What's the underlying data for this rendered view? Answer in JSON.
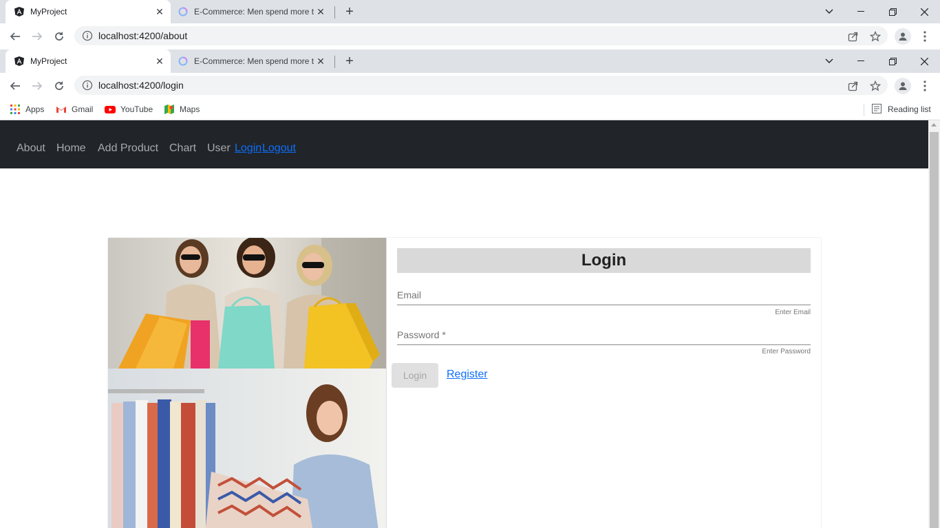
{
  "browser_top": {
    "tabs": [
      {
        "title": "MyProject"
      },
      {
        "title": "E-Commerce: Men spend more th"
      }
    ],
    "url": "localhost:4200/about"
  },
  "browser": {
    "tabs": [
      {
        "title": "MyProject"
      },
      {
        "title": "E-Commerce: Men spend more th"
      }
    ],
    "url": "localhost:4200/login",
    "bookmarks": [
      {
        "label": "Apps",
        "icon": "apps-grid-icon"
      },
      {
        "label": "Gmail",
        "icon": "gmail-icon"
      },
      {
        "label": "YouTube",
        "icon": "youtube-icon"
      },
      {
        "label": "Maps",
        "icon": "maps-icon"
      }
    ],
    "reading_list": "Reading list"
  },
  "navbar": {
    "links": [
      "About",
      "Home",
      "Add Product",
      "Chart",
      "User"
    ],
    "login": "Login",
    "logout": "Logout"
  },
  "login_form": {
    "title": "Login",
    "email_label": "Email",
    "email_hint": "Enter Email",
    "password_label": "Password *",
    "password_hint": "Enter Password",
    "login_button": "Login",
    "register_link": "Register"
  },
  "colors": {
    "navbar_bg": "#212529",
    "link": "#0d6efd",
    "title_bg": "#d9d9d9"
  }
}
